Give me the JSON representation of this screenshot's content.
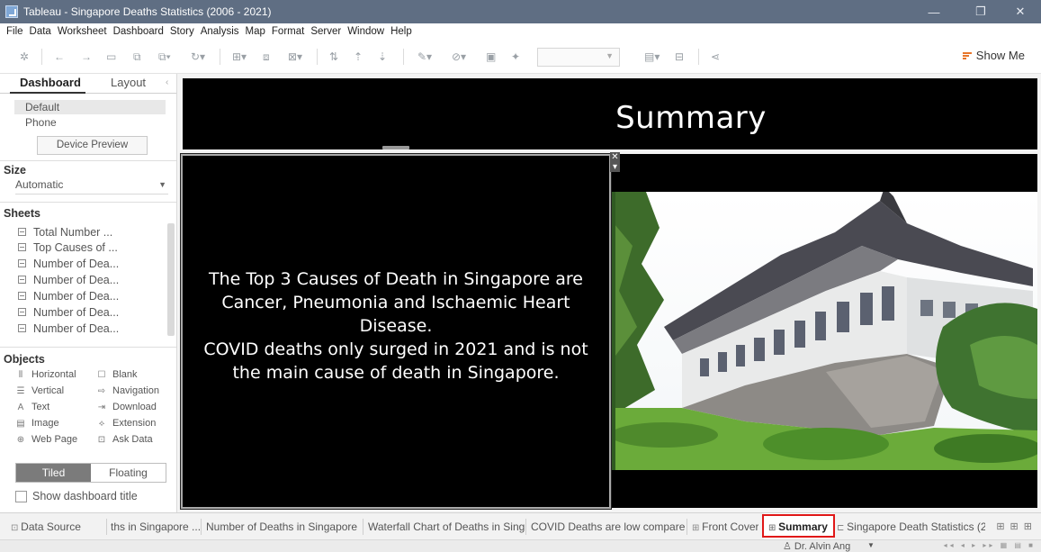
{
  "window": {
    "title": "Tableau - Singapore Deaths Statistics (2006 - 2021)",
    "minimize_icon": "minimize-icon",
    "maximize_icon": "restore-icon",
    "close_icon": "close-icon"
  },
  "menu": [
    "File",
    "Data",
    "Worksheet",
    "Dashboard",
    "Story",
    "Analysis",
    "Map",
    "Format",
    "Server",
    "Window",
    "Help"
  ],
  "toolbar": {
    "show_me_label": "Show Me"
  },
  "left_panel": {
    "tabs": [
      "Dashboard",
      "Layout"
    ],
    "devices": [
      "Default",
      "Phone"
    ],
    "device_preview_label": "Device Preview",
    "size_title": "Size",
    "size_value": "Automatic",
    "sheets_title": "Sheets",
    "sheets": [
      "Total Number ...",
      "Top Causes of ...",
      "Number of Dea...",
      "Number of Dea...",
      "Number of Dea...",
      "Number of Dea...",
      "Number of Dea..."
    ],
    "objects_title": "Objects",
    "objects": [
      {
        "label": "Horizontal",
        "icon": "horizontal-icon"
      },
      {
        "label": "Blank",
        "icon": "blank-icon"
      },
      {
        "label": "Vertical",
        "icon": "vertical-icon"
      },
      {
        "label": "Navigation",
        "icon": "navigation-icon"
      },
      {
        "label": "Text",
        "icon": "text-icon"
      },
      {
        "label": "Download",
        "icon": "download-icon"
      },
      {
        "label": "Image",
        "icon": "image-icon"
      },
      {
        "label": "Extension",
        "icon": "extension-icon"
      },
      {
        "label": "Web Page",
        "icon": "web-page-icon"
      },
      {
        "label": "Ask Data",
        "icon": "ask-data-icon"
      }
    ],
    "tiled_label": "Tiled",
    "floating_label": "Floating",
    "show_title_label": "Show dashboard title"
  },
  "dashboard": {
    "title": "Summary",
    "message_lines": [
      "The Top 3 Causes of Death in Singapore are",
      "Cancer, Pneumonia and Ischaemic Heart",
      "Disease.",
      "COVID deaths only surged in 2021 and is not",
      "the main cause of death in Singapore."
    ]
  },
  "sheet_tabs": [
    {
      "label": "Data Source",
      "icon": "data-source-icon"
    },
    {
      "label": "ths in Singapore ...",
      "icon": ""
    },
    {
      "label": "Number of Deaths in Singapore ...",
      "icon": ""
    },
    {
      "label": "Waterfall Chart of Deaths in Sing...",
      "icon": ""
    },
    {
      "label": "COVID Deaths are low compare...",
      "icon": ""
    },
    {
      "label": "Front Cover",
      "icon": "dashboard-icon"
    },
    {
      "label": "Summary",
      "icon": "dashboard-icon"
    },
    {
      "label": "Singapore Death Statistics (2...",
      "icon": "story-icon"
    }
  ],
  "status": {
    "user": "Dr. Alvin Ang"
  }
}
